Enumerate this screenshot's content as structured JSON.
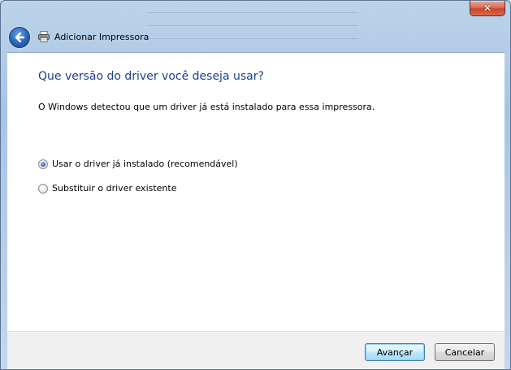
{
  "window": {
    "title": "Adicionar Impressora",
    "close_label": "✕"
  },
  "content": {
    "heading": "Que versão do driver você deseja usar?",
    "description": "O Windows detectou que um driver já está instalado para essa impressora.",
    "options": [
      {
        "label": "Usar o driver já instalado (recomendável)",
        "selected": true
      },
      {
        "label": "Substituir o driver existente",
        "selected": false
      }
    ]
  },
  "footer": {
    "next_label": "Avançar",
    "cancel_label": "Cancelar"
  },
  "colors": {
    "heading": "#1e3f8a",
    "accent": "#2a64b4"
  }
}
